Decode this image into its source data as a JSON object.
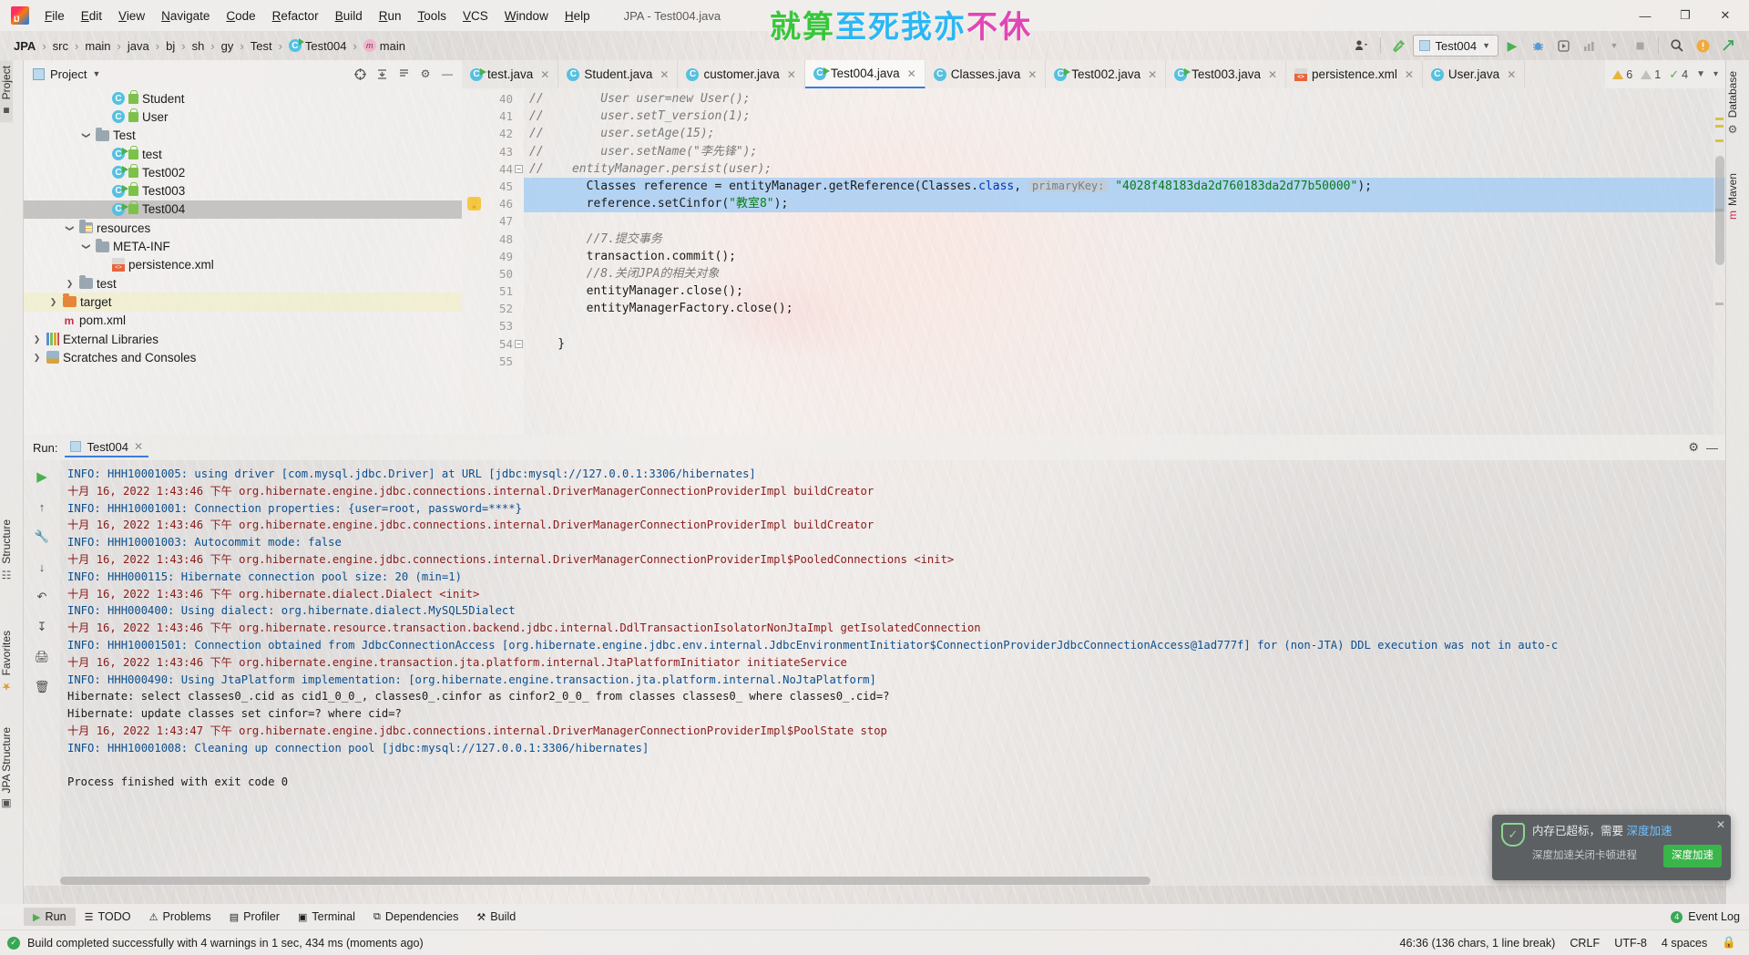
{
  "window": {
    "title": "JPA - Test004.java",
    "controls": [
      "—",
      "❐",
      "✕"
    ]
  },
  "watermark": {
    "green": "就算",
    "blue": "至死我亦",
    "pink": "不休"
  },
  "menu": [
    {
      "label": "File"
    },
    {
      "label": "Edit"
    },
    {
      "label": "View"
    },
    {
      "label": "Navigate"
    },
    {
      "label": "Code"
    },
    {
      "label": "Refactor"
    },
    {
      "label": "Build"
    },
    {
      "label": "Run"
    },
    {
      "label": "Tools"
    },
    {
      "label": "VCS"
    },
    {
      "label": "Window"
    },
    {
      "label": "Help"
    }
  ],
  "breadcrumb": [
    {
      "label": "JPA",
      "icon": "none",
      "bold": true
    },
    {
      "label": "src",
      "icon": "none",
      "bold": false
    },
    {
      "label": "main",
      "icon": "none",
      "bold": false
    },
    {
      "label": "java",
      "icon": "none",
      "bold": false
    },
    {
      "label": "bj",
      "icon": "none",
      "bold": false
    },
    {
      "label": "sh",
      "icon": "none",
      "bold": false
    },
    {
      "label": "gy",
      "icon": "none",
      "bold": false
    },
    {
      "label": "Test",
      "icon": "none",
      "bold": false
    },
    {
      "label": "Test004",
      "icon": "class-runnable-icon",
      "bold": false
    },
    {
      "label": "main",
      "icon": "method-icon",
      "bold": false
    }
  ],
  "toolbar": {
    "run_config": "Test004",
    "icons": [
      "user-dropdown-icon",
      "build-hammer-icon",
      "run-icon",
      "debug-icon",
      "run-coverage-icon",
      "profiler-icon",
      "more-icon",
      "stop-icon",
      "search-icon",
      "updates-icon",
      "share-icon"
    ]
  },
  "left_strip": [
    {
      "label": "Project",
      "active": true
    },
    {
      "label": "Structure",
      "active": false
    },
    {
      "label": "Favorites",
      "active": false
    },
    {
      "label": "JPA Structure",
      "active": false
    }
  ],
  "right_strip": [
    {
      "label": "Database"
    },
    {
      "label": "Maven"
    }
  ],
  "project_panel": {
    "title": "Project",
    "header_icons": [
      "target-icon",
      "collapse-all-icon",
      "expand-icon",
      "settings-gear-icon",
      "minimize-icon"
    ],
    "tree": [
      {
        "label": "Student",
        "depth": 4,
        "icon": "class-icon",
        "arrow": "",
        "state": "normal"
      },
      {
        "label": "User",
        "depth": 4,
        "icon": "class-icon",
        "arrow": "",
        "state": "normal"
      },
      {
        "label": "Test",
        "depth": 3,
        "icon": "folder-icon",
        "arrow": "⌄",
        "state": "normal"
      },
      {
        "label": "test",
        "depth": 4,
        "icon": "class-runnable-icon",
        "arrow": "",
        "state": "normal"
      },
      {
        "label": "Test002",
        "depth": 4,
        "icon": "class-runnable-icon",
        "arrow": "",
        "state": "normal"
      },
      {
        "label": "Test003",
        "depth": 4,
        "icon": "class-runnable-icon",
        "arrow": "",
        "state": "normal"
      },
      {
        "label": "Test004",
        "depth": 4,
        "icon": "class-runnable-icon",
        "arrow": "",
        "state": "selected"
      },
      {
        "label": "resources",
        "depth": 2,
        "icon": "resources-folder-icon",
        "arrow": "⌄",
        "state": "normal"
      },
      {
        "label": "META-INF",
        "depth": 3,
        "icon": "folder-icon",
        "arrow": "⌄",
        "state": "normal"
      },
      {
        "label": "persistence.xml",
        "depth": 4,
        "icon": "xml-file-icon",
        "arrow": "",
        "state": "normal"
      },
      {
        "label": "test",
        "depth": 2,
        "icon": "folder-icon",
        "arrow": "›",
        "state": "normal"
      },
      {
        "label": "target",
        "depth": 1,
        "icon": "target-folder-icon",
        "arrow": "›",
        "state": "highlight"
      },
      {
        "label": "pom.xml",
        "depth": 1,
        "icon": "maven-icon",
        "arrow": "",
        "state": "normal"
      },
      {
        "label": "External Libraries",
        "depth": 0,
        "icon": "library-icon",
        "arrow": "›",
        "state": "normal"
      },
      {
        "label": "Scratches and Consoles",
        "depth": 0,
        "icon": "scratch-icon",
        "arrow": "›",
        "state": "normal"
      }
    ]
  },
  "editor": {
    "tabs": [
      {
        "label": "test.java",
        "icon": "class-runnable-icon",
        "active": false
      },
      {
        "label": "Student.java",
        "icon": "class-icon",
        "active": false
      },
      {
        "label": "customer.java",
        "icon": "class-icon",
        "active": false
      },
      {
        "label": "Test004.java",
        "icon": "class-runnable-icon",
        "active": true
      },
      {
        "label": "Classes.java",
        "icon": "class-icon",
        "active": false
      },
      {
        "label": "Test002.java",
        "icon": "class-runnable-icon",
        "active": false
      },
      {
        "label": "Test003.java",
        "icon": "class-runnable-icon",
        "active": false
      },
      {
        "label": "persistence.xml",
        "icon": "xml-file-icon",
        "active": false
      },
      {
        "label": "User.java",
        "icon": "class-icon",
        "active": false
      }
    ],
    "inspections": {
      "warnings": "6",
      "weak_warnings": "1",
      "typos": "4"
    },
    "lines": [
      {
        "no": "40",
        "fold": "",
        "bulb": false,
        "hl": "",
        "tokens": [
          {
            "t": "//",
            "c": "cmt"
          },
          {
            "t": "        User user=new User();",
            "c": "cmt"
          }
        ]
      },
      {
        "no": "41",
        "fold": "",
        "bulb": false,
        "hl": "",
        "tokens": [
          {
            "t": "//",
            "c": "cmt"
          },
          {
            "t": "        user.setT_version(1);",
            "c": "cmt"
          }
        ]
      },
      {
        "no": "42",
        "fold": "",
        "bulb": false,
        "hl": "",
        "tokens": [
          {
            "t": "//",
            "c": "cmt"
          },
          {
            "t": "        user.setAge(15);",
            "c": "cmt"
          }
        ]
      },
      {
        "no": "43",
        "fold": "",
        "bulb": false,
        "hl": "",
        "tokens": [
          {
            "t": "//",
            "c": "cmt"
          },
          {
            "t": "        user.setName(\"李先锋\");",
            "c": "cmt"
          }
        ]
      },
      {
        "no": "44",
        "fold": "⊖",
        "bulb": false,
        "hl": "",
        "tokens": [
          {
            "t": "//",
            "c": "cmt"
          },
          {
            "t": "    entityManager.persist(user);",
            "c": "cmt"
          }
        ]
      },
      {
        "no": "45",
        "fold": "",
        "bulb": false,
        "hl": "hl",
        "tokens": [
          {
            "t": "        Classes reference = entityManager.getReference(Classes.",
            "c": "plain"
          },
          {
            "t": "class",
            "c": "kw"
          },
          {
            "t": ", ",
            "c": "plain"
          },
          {
            "t": "primaryKey:",
            "c": "hint"
          },
          {
            "t": " ",
            "c": "plain"
          },
          {
            "t": "\"4028f48183da2d760183da2d77b50000\"",
            "c": "str"
          },
          {
            "t": ");",
            "c": "plain"
          }
        ]
      },
      {
        "no": "46",
        "fold": "",
        "bulb": true,
        "hl": "hl",
        "tokens": [
          {
            "t": "        reference.setCinfor(",
            "c": "plain"
          },
          {
            "t": "\"教室8\"",
            "c": "str"
          },
          {
            "t": ");",
            "c": "plain"
          }
        ]
      },
      {
        "no": "47",
        "fold": "",
        "bulb": false,
        "hl": "",
        "tokens": [
          {
            "t": "",
            "c": "plain"
          }
        ]
      },
      {
        "no": "48",
        "fold": "",
        "bulb": false,
        "hl": "",
        "tokens": [
          {
            "t": "        //7.提交事务",
            "c": "cmt"
          }
        ]
      },
      {
        "no": "49",
        "fold": "",
        "bulb": false,
        "hl": "",
        "tokens": [
          {
            "t": "        transaction.commit();",
            "c": "plain"
          }
        ]
      },
      {
        "no": "50",
        "fold": "",
        "bulb": false,
        "hl": "",
        "tokens": [
          {
            "t": "        //8.关闭JPA的相关对象",
            "c": "cmt"
          }
        ]
      },
      {
        "no": "51",
        "fold": "",
        "bulb": false,
        "hl": "",
        "tokens": [
          {
            "t": "        entityManager.close();",
            "c": "plain"
          }
        ]
      },
      {
        "no": "52",
        "fold": "",
        "bulb": false,
        "hl": "",
        "tokens": [
          {
            "t": "        entityManagerFactory.close();",
            "c": "plain"
          }
        ]
      },
      {
        "no": "53",
        "fold": "",
        "bulb": false,
        "hl": "",
        "tokens": [
          {
            "t": "",
            "c": "plain"
          }
        ]
      },
      {
        "no": "54",
        "fold": "⊖",
        "bulb": false,
        "hl": "",
        "tokens": [
          {
            "t": "    }",
            "c": "plain"
          }
        ]
      },
      {
        "no": "55",
        "fold": "",
        "bulb": false,
        "hl": "",
        "tokens": [
          {
            "t": "",
            "c": "plain"
          }
        ]
      }
    ]
  },
  "run_panel": {
    "label": "Run:",
    "tab": "Test004",
    "side_icons": [
      "rerun-icon",
      "stop-icon",
      "wrench-icon",
      "up-arrow-icon",
      "down-arrow-icon",
      "soft-wrap-icon",
      "scroll-to-end-icon",
      "print-icon",
      "clear-all-icon"
    ],
    "console": [
      {
        "text": "INFO: HHH10001005: using driver [com.mysql.jdbc.Driver] at URL [jdbc:mysql://127.0.0.1:3306/hibernates]",
        "color": "lg-info"
      },
      {
        "text": "十月 16, 2022 1:43:46 下午 org.hibernate.engine.jdbc.connections.internal.DriverManagerConnectionProviderImpl buildCreator",
        "color": "lg-red"
      },
      {
        "text": "INFO: HHH10001001: Connection properties: {user=root, password=****}",
        "color": "lg-info"
      },
      {
        "text": "十月 16, 2022 1:43:46 下午 org.hibernate.engine.jdbc.connections.internal.DriverManagerConnectionProviderImpl buildCreator",
        "color": "lg-red"
      },
      {
        "text": "INFO: HHH10001003: Autocommit mode: false",
        "color": "lg-info"
      },
      {
        "text": "十月 16, 2022 1:43:46 下午 org.hibernate.engine.jdbc.connections.internal.DriverManagerConnectionProviderImpl$PooledConnections <init>",
        "color": "lg-red"
      },
      {
        "text": "INFO: HHH000115: Hibernate connection pool size: 20 (min=1)",
        "color": "lg-info"
      },
      {
        "text": "十月 16, 2022 1:43:46 下午 org.hibernate.dialect.Dialect <init>",
        "color": "lg-red"
      },
      {
        "text": "INFO: HHH000400: Using dialect: org.hibernate.dialect.MySQL5Dialect",
        "color": "lg-info"
      },
      {
        "text": "十月 16, 2022 1:43:46 下午 org.hibernate.resource.transaction.backend.jdbc.internal.DdlTransactionIsolatorNonJtaImpl getIsolatedConnection",
        "color": "lg-red"
      },
      {
        "text": "INFO: HHH10001501: Connection obtained from JdbcConnectionAccess [org.hibernate.engine.jdbc.env.internal.JdbcEnvironmentInitiator$ConnectionProviderJdbcConnectionAccess@1ad777f] for (non-JTA) DDL execution was not in auto-c",
        "color": "lg-info"
      },
      {
        "text": "十月 16, 2022 1:43:46 下午 org.hibernate.engine.transaction.jta.platform.internal.JtaPlatformInitiator initiateService",
        "color": "lg-red"
      },
      {
        "text": "INFO: HHH000490: Using JtaPlatform implementation: [org.hibernate.engine.transaction.jta.platform.internal.NoJtaPlatform]",
        "color": "lg-info"
      },
      {
        "text": "Hibernate: select classes0_.cid as cid1_0_0_, classes0_.cinfor as cinfor2_0_0_ from classes classes0_ where classes0_.cid=?",
        "color": "lg-dark"
      },
      {
        "text": "Hibernate: update classes set cinfor=? where cid=?",
        "color": "lg-dark"
      },
      {
        "text": "十月 16, 2022 1:43:47 下午 org.hibernate.engine.jdbc.connections.internal.DriverManagerConnectionProviderImpl$PoolState stop",
        "color": "lg-red"
      },
      {
        "text": "INFO: HHH10001008: Cleaning up connection pool [jdbc:mysql://127.0.0.1:3306/hibernates]",
        "color": "lg-info"
      },
      {
        "text": "",
        "color": "lg-dark"
      },
      {
        "text": "Process finished with exit code 0",
        "color": "lg-dark"
      }
    ]
  },
  "balloon": {
    "title_pre": "内存已超标，需要 ",
    "title_link": "深度加速",
    "sub": "深度加速关闭卡顿进程",
    "cta": "深度加速",
    "close": "✕"
  },
  "bottom_bar": {
    "items": [
      {
        "label": "Run",
        "icon": "play-icon",
        "active": true
      },
      {
        "label": "TODO",
        "icon": "todo-icon",
        "active": false
      },
      {
        "label": "Problems",
        "icon": "problems-icon",
        "active": false
      },
      {
        "label": "Profiler",
        "icon": "profiler-icon",
        "active": false
      },
      {
        "label": "Terminal",
        "icon": "terminal-icon",
        "active": false
      },
      {
        "label": "Dependencies",
        "icon": "dependencies-icon",
        "active": false
      },
      {
        "label": "Build",
        "icon": "build-icon",
        "active": false
      }
    ],
    "event_log": "Event Log",
    "event_count": "4"
  },
  "status_bar": {
    "message": "Build completed successfully with 4 warnings in 1 sec, 434 ms (moments ago)",
    "caret": "46:36 (136 chars, 1 line break)",
    "line_sep": "CRLF",
    "encoding": "UTF-8",
    "indent": "4 spaces"
  }
}
